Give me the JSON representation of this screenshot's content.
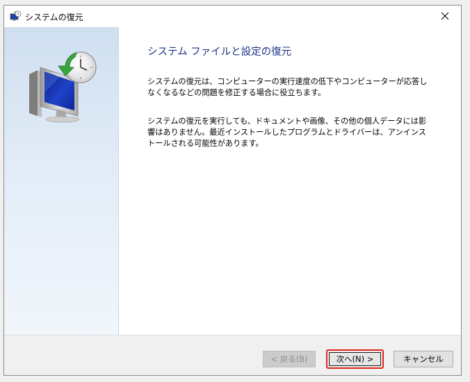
{
  "window": {
    "title": "システムの復元"
  },
  "main": {
    "heading": "システム ファイルと設定の復元",
    "paragraph1": "システムの復元は、コンピューターの実行速度の低下やコンピューターが応答しなくなるなどの問題を修正する場合に役立ちます。",
    "paragraph2": "システムの復元を実行しても、ドキュメントや画像、その他の個人データには影響はありません。最近インストールしたプログラムとドライバーは、アンインストールされる可能性があります。"
  },
  "footer": {
    "back_label": "< 戻る(B)",
    "next_label": "次へ(N) >",
    "cancel_label": "キャンセル"
  },
  "colors": {
    "heading": "#1e3287",
    "highlight": "#e0231c"
  },
  "icons": {
    "title": "system-restore-icon",
    "hero": "system-restore-monitor-clock-icon",
    "close": "close-icon"
  }
}
